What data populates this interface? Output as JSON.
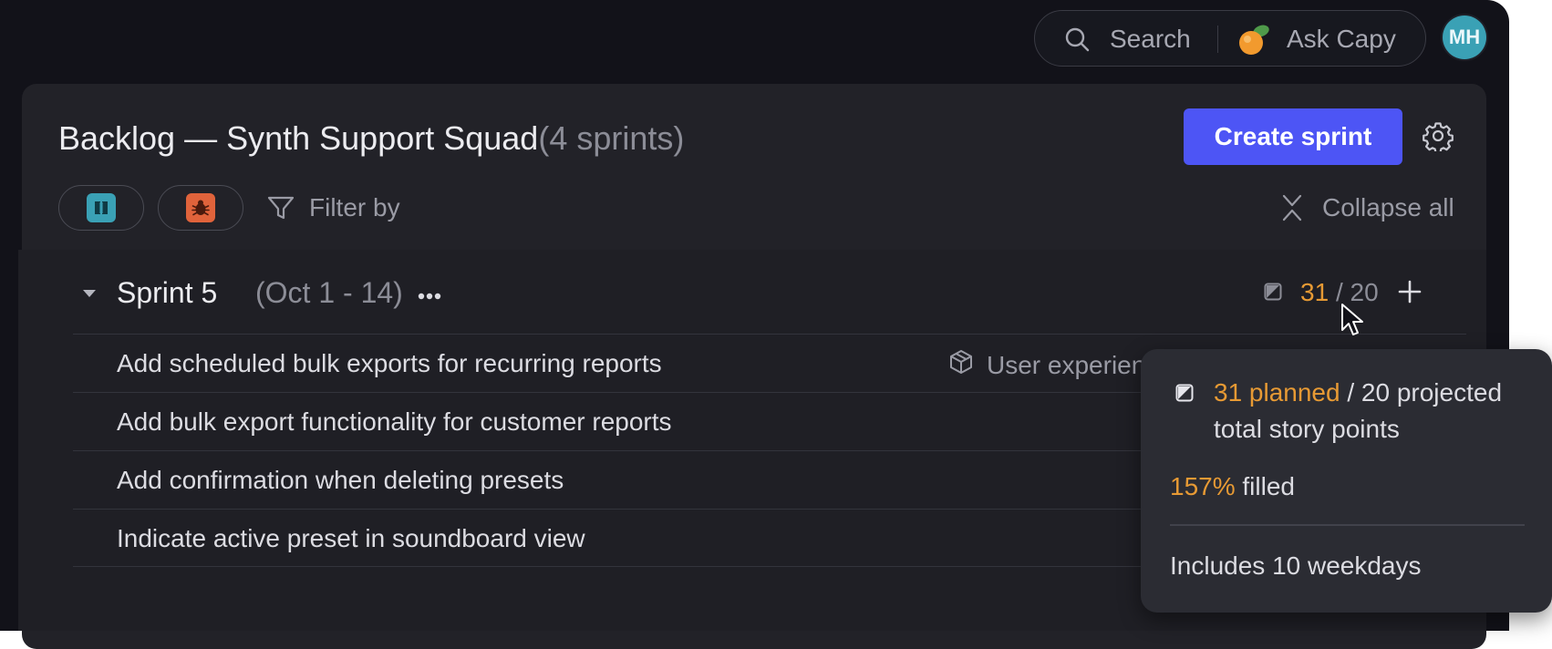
{
  "topbar": {
    "search_label": "Search",
    "ask_label": "Ask Capy",
    "avatar_initials": "MH",
    "avatar_color": "#3aa1b5"
  },
  "header": {
    "title": "Backlog — Synth Support Squad",
    "sprint_count": "(4 sprints)",
    "create_button": "Create sprint",
    "accent_color": "#4d55f5"
  },
  "filters": {
    "chips": [
      {
        "type": "story",
        "icon": "book-icon",
        "color": "#3aa1b5"
      },
      {
        "type": "bug",
        "icon": "bug-icon",
        "color": "#e0633b"
      }
    ],
    "filter_label": "Filter by",
    "collapse_label": "Collapse all"
  },
  "sprint": {
    "name": "Sprint 5",
    "dates": "(Oct 1 - 14)",
    "points_planned": "31",
    "points_separator": "/",
    "points_projected": "20",
    "issues": [
      {
        "title": "Add scheduled bulk exports for recurring reports",
        "epic": "User experienc"
      },
      {
        "title": "Add bulk export functionality for customer reports",
        "epic": ""
      },
      {
        "title": "Add confirmation when deleting presets",
        "epic": ""
      },
      {
        "title": "Indicate active preset in soundboard view",
        "epic": ""
      }
    ]
  },
  "tooltip": {
    "planned": "31 planned",
    "projected_rest": " / 20 projected",
    "line2": "total story points",
    "fill_pct": "157%",
    "fill_text": " filled",
    "weekdays": "Includes 10 weekdays",
    "highlight_color": "#e79a34"
  }
}
